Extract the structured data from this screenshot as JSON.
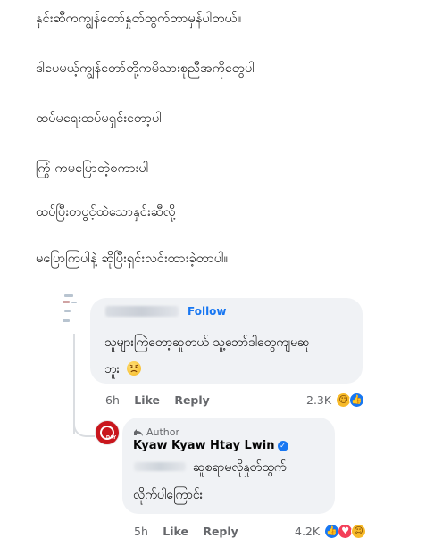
{
  "post": {
    "lines": [
      "နှင်းဆီကကျွန်တော်နှုတ်ထွက်တာမှန်ပါတယ်။",
      "ဒါပေမယ့်ကျွန်တော်တို့ကမိသားစုညီအကိုတွေပါ",
      "ထပ်မရေးထပ်မရှင်းတော့ပါ",
      "ကြွံ ကမပြောတဲ့စကားပါ",
      "ထပ်ပြီးတပွင့်ထဲသောနှင်းဆီလို့",
      "မပြောကြပါနဲ့ ဆိုပြီးရှင်းလင်းထားခဲ့တာပါ။"
    ]
  },
  "comment1": {
    "follow_label": "Follow",
    "text_line1": "သူများကြဲတော့ဆူတယ် သူ့ဘော်ဒါတွေကျမဆူ",
    "text_line2": "ဘူး",
    "emoji": "frowning-face-emoji",
    "time": "6h",
    "like_label": "Like",
    "reply_label": "Reply",
    "reaction_count": "2.3K",
    "reactions": [
      "haha-icon",
      "like-icon"
    ]
  },
  "reply": {
    "author_badge": "Author",
    "author_name": "Kyaw Kyaw Htay Lwin",
    "text_line1": "ဆူစရာမလိုနှုတ်ထွက်",
    "text_line2": "လိုက်ပါကြောင်း",
    "time": "5h",
    "like_label": "Like",
    "reply_label": "Reply",
    "reaction_count": "4.2K",
    "reactions": [
      "like-icon",
      "love-icon",
      "care-icon"
    ]
  },
  "colors": {
    "accent": "#1877f2",
    "bubble": "#f0f2f5",
    "meta": "#65676b",
    "avatar_red": "#c9161d"
  }
}
